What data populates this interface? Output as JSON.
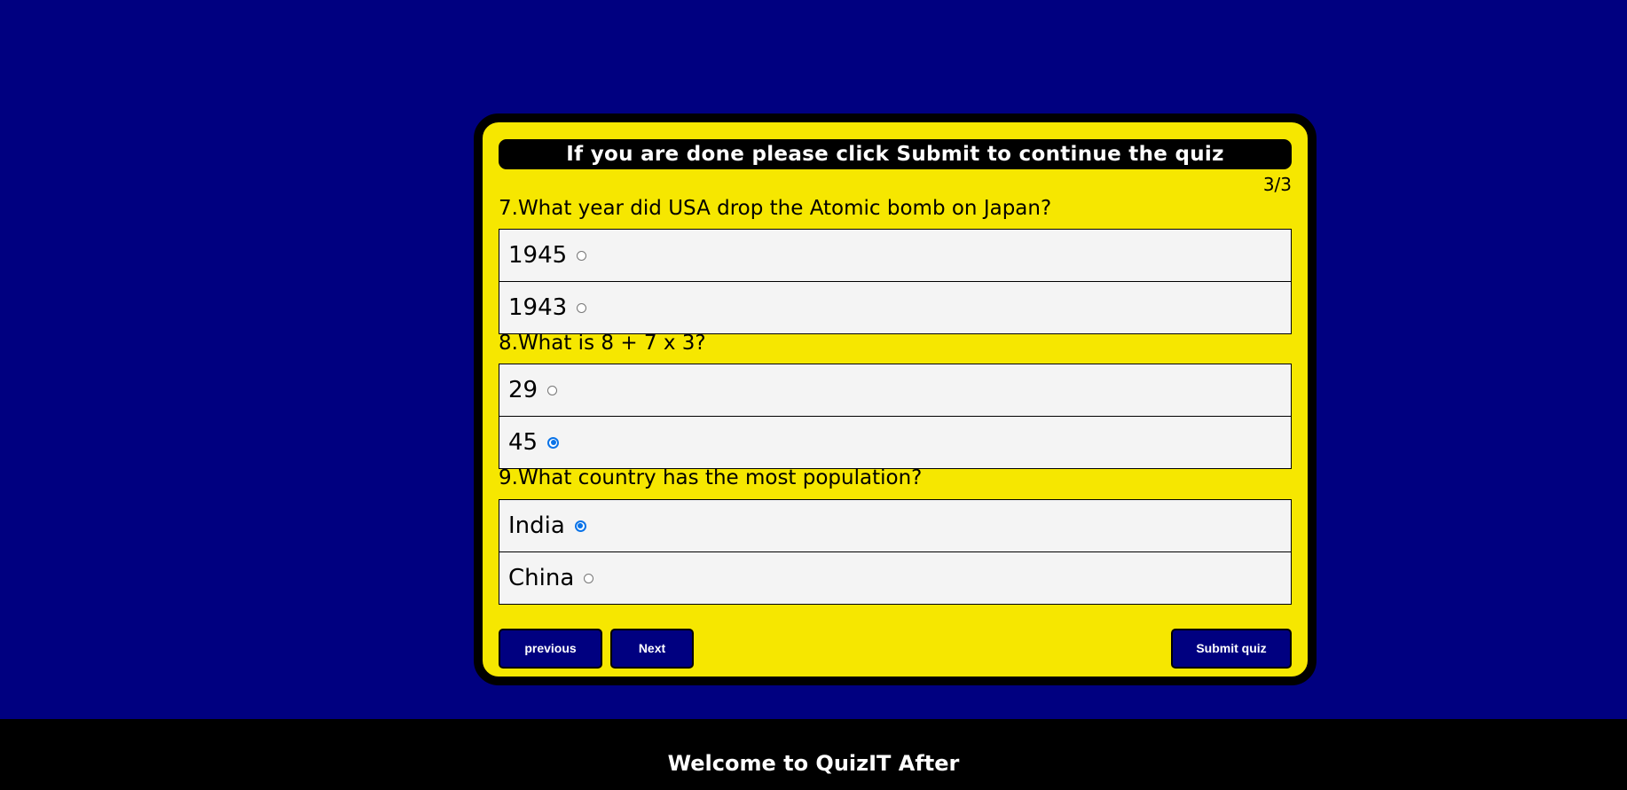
{
  "quiz": {
    "banner": "If you are done please click Submit to continue the quiz",
    "page_counter": "3/3",
    "questions": [
      {
        "text": "7.What year did USA drop the Atomic bomb on Japan?",
        "options": [
          {
            "label": "1945",
            "selected": false
          },
          {
            "label": "1943",
            "selected": false
          }
        ]
      },
      {
        "text": "8.What is 8 + 7 x 3?",
        "options": [
          {
            "label": "29",
            "selected": false
          },
          {
            "label": "45",
            "selected": true
          }
        ]
      },
      {
        "text": "9.What country has the most population?",
        "options": [
          {
            "label": "India",
            "selected": true
          },
          {
            "label": "China",
            "selected": false
          }
        ]
      }
    ],
    "buttons": {
      "previous": "previous",
      "next": "Next",
      "submit": "Submit quiz"
    }
  },
  "footer": {
    "title": "Welcome to QuizIT After"
  },
  "colors": {
    "page_background": "#000080",
    "card_background": "#f6e700",
    "button_background": "#000080",
    "radio_checked": "#0a73e8"
  }
}
